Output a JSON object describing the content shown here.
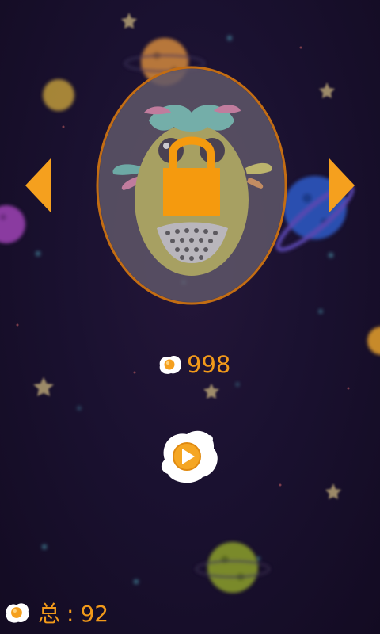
{
  "screen": {
    "name": "character-select",
    "locked": true
  },
  "price": {
    "icon": "fried-egg-icon",
    "value": "998"
  },
  "play_button": {
    "icon": "play-icon"
  },
  "total": {
    "icon": "fried-egg-icon",
    "label": "总",
    "separator": ":",
    "value": "92"
  },
  "colors": {
    "accent": "#f29a1a",
    "background": "#1a1130"
  }
}
